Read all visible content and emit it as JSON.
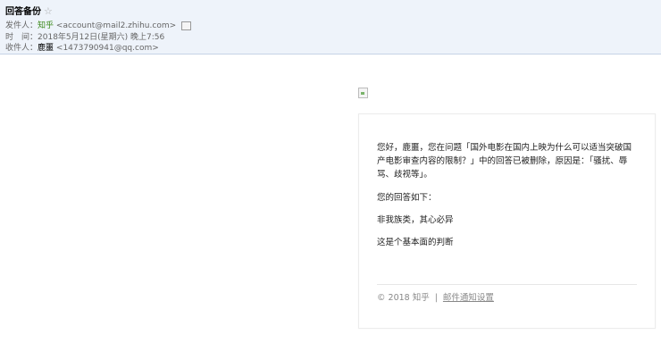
{
  "header": {
    "subject": "回答备份",
    "star_icon": "☆",
    "from_label": "发件人：",
    "from_name": "知乎",
    "from_email": "<account@mail2.zhihu.com>",
    "time_label": "时　间：",
    "time_value": "2018年5月12日(星期六) 晚上7:56",
    "to_label": "收件人：",
    "to_name": "鹿噩",
    "to_email": "<1473790941@qq.com>"
  },
  "body": {
    "intro": "您好，鹿噩，您在问题「国外电影在国内上映为什么可以适当突破国产电影审查内容的限制？」中的回答已被删除，原因是：「骚扰、辱骂、歧视等」。",
    "answer_label": "您的回答如下：",
    "answer_line1": "非我族类，其心必异",
    "answer_line2": "这是个基本面的判断",
    "footer_copyright": "© 2018 知乎",
    "footer_separator": "|",
    "footer_link": "邮件通知设置"
  }
}
